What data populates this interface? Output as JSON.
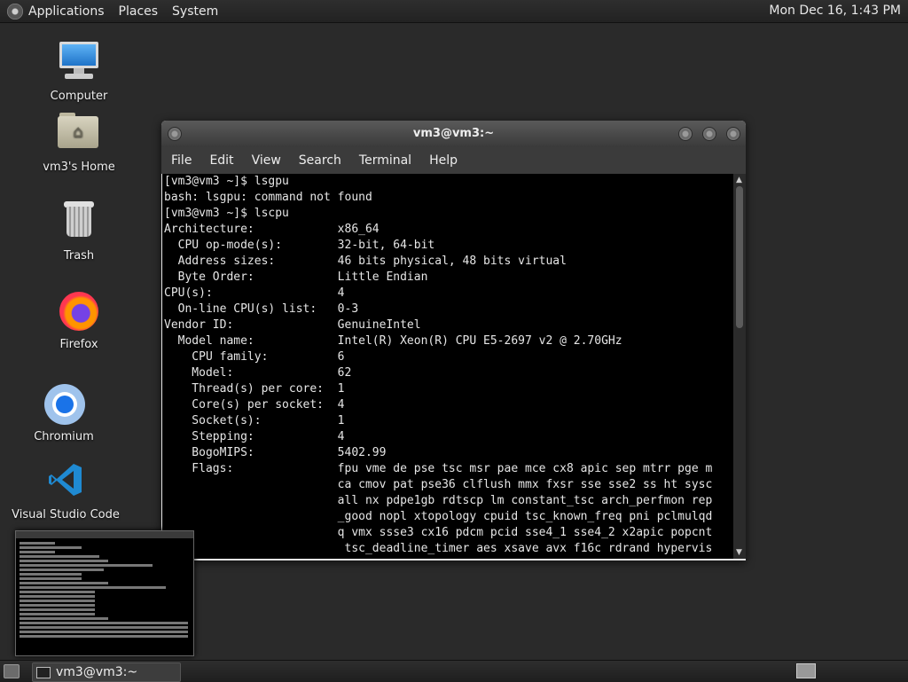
{
  "top_panel": {
    "menus": [
      "Applications",
      "Places",
      "System"
    ],
    "clock": "Mon Dec 16,  1:43 PM"
  },
  "desktop_icons": [
    {
      "label": "Computer",
      "icon": "computer-icon"
    },
    {
      "label": "vm3's Home",
      "icon": "home-folder-icon"
    },
    {
      "label": "Trash",
      "icon": "trash-icon"
    },
    {
      "label": "Firefox",
      "icon": "firefox-icon"
    },
    {
      "label": "Chromium",
      "icon": "chromium-icon"
    },
    {
      "label": "Visual Studio Code",
      "icon": "vscode-icon"
    }
  ],
  "terminal": {
    "title": "vm3@vm3:~",
    "menu": [
      "File",
      "Edit",
      "View",
      "Search",
      "Terminal",
      "Help"
    ],
    "lines": [
      "[vm3@vm3 ~]$ lsgpu",
      "bash: lsgpu: command not found",
      "[vm3@vm3 ~]$ lscpu",
      "Architecture:            x86_64",
      "  CPU op-mode(s):        32-bit, 64-bit",
      "  Address sizes:         46 bits physical, 48 bits virtual",
      "  Byte Order:            Little Endian",
      "CPU(s):                  4",
      "  On-line CPU(s) list:   0-3",
      "Vendor ID:               GenuineIntel",
      "  Model name:            Intel(R) Xeon(R) CPU E5-2697 v2 @ 2.70GHz",
      "    CPU family:          6",
      "    Model:               62",
      "    Thread(s) per core:  1",
      "    Core(s) per socket:  4",
      "    Socket(s):           1",
      "    Stepping:            4",
      "    BogoMIPS:            5402.99",
      "    Flags:               fpu vme de pse tsc msr pae mce cx8 apic sep mtrr pge m",
      "                         ca cmov pat pse36 clflush mmx fxsr sse sse2 ss ht sysc",
      "                         all nx pdpe1gb rdtscp lm constant_tsc arch_perfmon rep",
      "                         _good nopl xtopology cpuid tsc_known_freq pni pclmulqd",
      "                         q vmx ssse3 cx16 pdcm pcid sse4_1 sse4_2 x2apic popcnt",
      "                          tsc_deadline_timer aes xsave avx f16c rdrand hypervis"
    ]
  },
  "taskbar": {
    "window_label": "vm3@vm3:~"
  }
}
